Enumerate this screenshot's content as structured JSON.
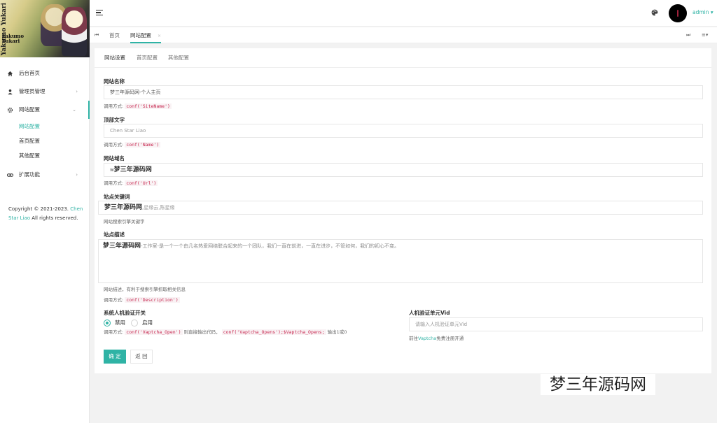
{
  "logo": {
    "text_line1": "Yakumo Yukari",
    "sign_line1": "Yakumo",
    "sign_line2": "Yukari"
  },
  "sidebar": {
    "items": [
      {
        "label": "后台首页",
        "icon": "home-icon"
      },
      {
        "label": "管理员管理",
        "icon": "user-icon",
        "chevron": "›"
      },
      {
        "label": "网站配置",
        "icon": "gear-icon",
        "chevron": "⌄"
      },
      {
        "label": "扩展功能",
        "icon": "link-icon",
        "chevron": "›"
      }
    ],
    "subitems": [
      {
        "label": "网站配置",
        "active": true
      },
      {
        "label": "首页配置"
      },
      {
        "label": "其他配置"
      }
    ],
    "copyright_prefix": "Copyright © 2021-2023.",
    "copyright_name": "Chen Star Liao",
    "copyright_suffix": "All rights reserved."
  },
  "header": {
    "user": "admin ▾",
    "accent": "#2fb3a5"
  },
  "tabsbar": {
    "prev": "⏮",
    "home": "首页",
    "current": "网站配置",
    "close": "×",
    "next": "⏭",
    "menu": "≡▾"
  },
  "card": {
    "tabs": [
      "网站设置",
      "首页配置",
      "其他配置"
    ],
    "site_name": {
      "label": "网站名称",
      "value": "梦三年源码网-个人主页",
      "help_prefix": "调用方式:",
      "code": "conf('SiteName')"
    },
    "top_text": {
      "label": "顶部文字",
      "value": "Chen Star Liao",
      "help_prefix": "调用方式:",
      "code": "conf('Name')"
    },
    "domain": {
      "label": "网站域名",
      "value_prefix": "w",
      "value_big": "梦三年源码网",
      "help_prefix": "调用方式:",
      "code": "conf('Url')"
    },
    "keywords": {
      "label": "站点关键词",
      "value_big": "梦三年源码网",
      "value_rest": ",星缘云,陈星缘",
      "help": "网站搜索引擎关键字"
    },
    "description": {
      "label": "站点描述",
      "value_big": "梦三年源码网",
      "value_rest": "-工作室-是一个一个由几名热爱网络联合起来的一个团队，我们一直在前进，一直在进步，不管如何，我们的初心不变。",
      "help": "网站描述，有利于搜索引擎抓取相关信息",
      "help2_prefix": "调用方式:",
      "code": "conf('Description')"
    },
    "captcha": {
      "label": "系统人机验证开关",
      "opt_off": "禁用",
      "opt_on": "启用",
      "help_prefix": "调用方式:",
      "code1": "conf('Vaptcha_Open')",
      "help_mid": "则直接输出代码，",
      "code2": "conf('Vaptcha_Opens');$Vaptcha_Opens;",
      "help_suffix": "输出1或0"
    },
    "vid": {
      "label": "人机验证单元Vid",
      "placeholder": "请输入人机验证单元Vid",
      "help_prefix": "前往",
      "help_link": "Vaptcha",
      "help_suffix": "免费注册开通"
    },
    "btn_ok": "确 定",
    "btn_back": "返 回"
  },
  "watermark": "梦三年源码网"
}
